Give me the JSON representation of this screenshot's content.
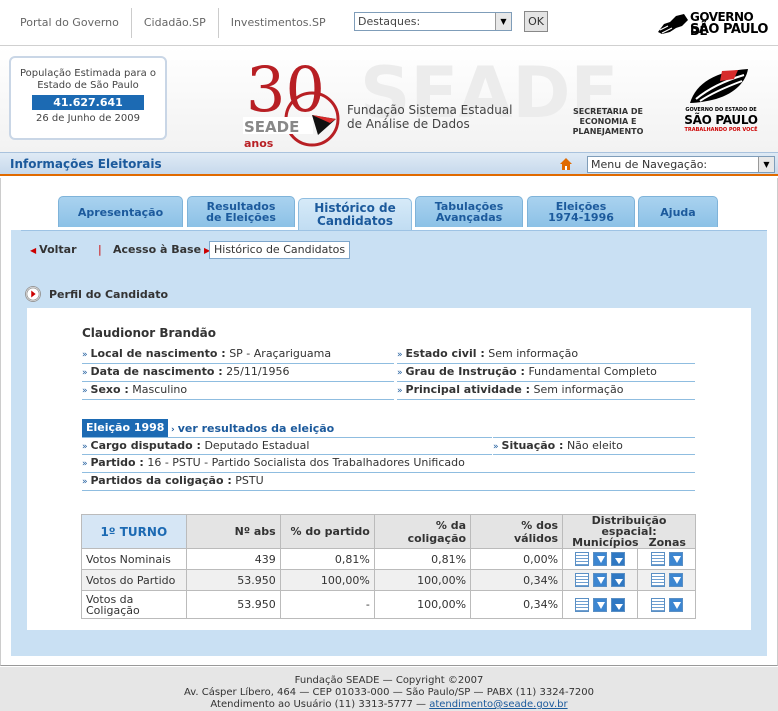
{
  "topbar": {
    "links": [
      "Portal do Governo",
      "Cidadão.SP",
      "Investimentos.SP"
    ],
    "destaques_value": "Destaques:",
    "ok_label": "OK",
    "gov_logo_line1": "GOVERNO DE",
    "gov_logo_line2": "SÃO PAULO"
  },
  "banner": {
    "pop_label": "População Estimada para o Estado de São Paulo",
    "pop_value": "41.627.641",
    "pop_date": "26 de Junho de 2009",
    "seade_anos": "anos",
    "seade_word": "SEADE",
    "seade_number": "30",
    "seade_name_line1": "Fundação Sistema Estadual",
    "seade_name_line2": "de Análise de Dados",
    "secretaria": "SECRETARIA DE ECONOMIA E PLANEJAMENTO",
    "sp_logo_line1": "GOVERNO DO ESTADO DE",
    "sp_logo_line2": "SÃO PAULO",
    "sp_logo_line3": "TRABALHANDO POR VOCÊ"
  },
  "section": {
    "title": "Informações Eleitorais",
    "nav_menu": "Menu de Navegação:"
  },
  "tabs": [
    {
      "line1": "Apresentação",
      "line2": ""
    },
    {
      "line1": "Resultados",
      "line2": "de Eleições"
    },
    {
      "line1": "Histórico de",
      "line2": "Candidatos"
    },
    {
      "line1": "Tabulações",
      "line2": "Avançadas"
    },
    {
      "line1": "Eleições",
      "line2": "1974-1996"
    },
    {
      "line1": "Ajuda",
      "line2": ""
    }
  ],
  "crumbs": {
    "back": "Voltar",
    "sep": "|",
    "base": "Acesso à Base",
    "current": "Histórico de Candidatos"
  },
  "perfil": {
    "title": "Perfil do Candidato",
    "name": "Claudionor Brandão",
    "fields": {
      "local_label": "Local de nascimento :",
      "local_value": "SP - Araçariguama",
      "estado_label": "Estado civil :",
      "estado_value": "Sem informação",
      "data_label": "Data de nascimento :",
      "data_value": "25/11/1956",
      "grau_label": "Grau de Instrução :",
      "grau_value": "Fundamental Completo",
      "sexo_label": "Sexo :",
      "sexo_value": "Masculino",
      "ativ_label": "Principal atividade :",
      "ativ_value": "Sem informação"
    }
  },
  "eleicao": {
    "badge": "Eleição 1998",
    "ver_resultados": "ver resultados da eleição",
    "cargo_label": "Cargo disputado :",
    "cargo_value": "Deputado Estadual",
    "situacao_label": "Situação :",
    "situacao_value": "Não eleito",
    "partido_label": "Partido :",
    "partido_value": "16 - PSTU - Partido Socialista dos Trabalhadores Unificado",
    "coligacao_label": "Partidos da coligação :",
    "coligacao_value": "PSTU"
  },
  "table": {
    "turno": "1º TURNO",
    "headers": [
      "Nº abs",
      "% do partido",
      "% da coligação",
      "% dos válidos"
    ],
    "dist_title": "Distribuição espacial:",
    "dist_municipios": "Municípios",
    "dist_zonas": "Zonas",
    "rows": [
      {
        "label": "Votos Nominais",
        "abs": "439",
        "partido": "0,81%",
        "coligacao": "0,81%",
        "validos": "0,00%"
      },
      {
        "label": "Votos do Partido",
        "abs": "53.950",
        "partido": "100,00%",
        "coligacao": "100,00%",
        "validos": "0,34%"
      },
      {
        "label": "Votos da Coligação",
        "abs": "53.950",
        "partido": "-",
        "coligacao": "100,00%",
        "validos": "0,34%"
      }
    ]
  },
  "footer": {
    "line1": "Fundação SEADE — Copyright ©2007",
    "line2": "Av. Cásper Líbero, 464 — CEP 01033-000 — São Paulo/SP — PABX (11) 3324-7200",
    "line3": "Atendimento ao Usuário (11) 3313-5777 —",
    "email": "atendimento@seade.gov.br"
  },
  "colors": {
    "accent_blue": "#1c6ab3",
    "tab_blue": "#8cc1e6",
    "seade_red": "#c0282b",
    "orange_rule": "#e06a00"
  }
}
